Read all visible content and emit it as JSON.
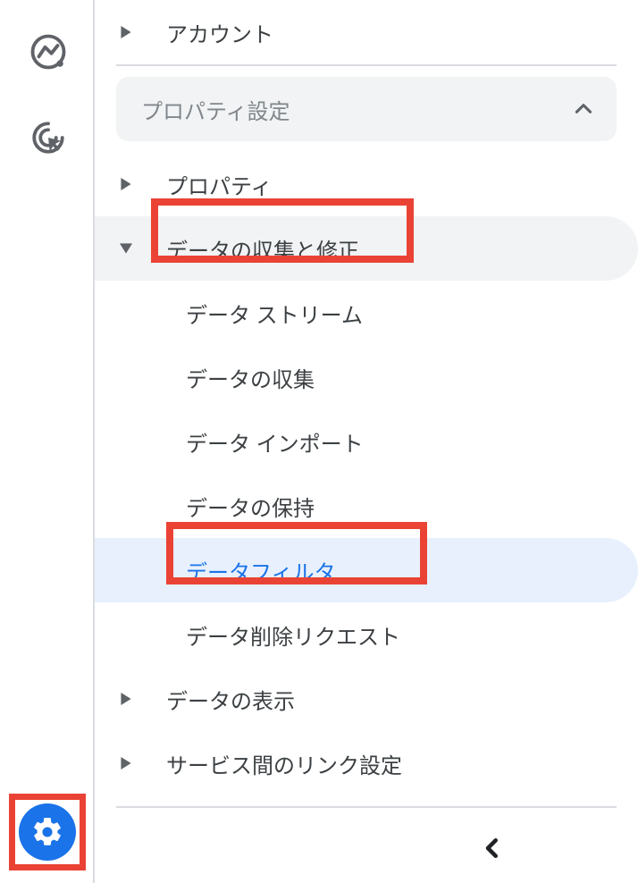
{
  "sidebar": {
    "account_label": "アカウント",
    "section_header": "プロパティ設定",
    "items": {
      "property": "プロパティ",
      "data_collect_mod": "データの収集と修正",
      "data_display": "データの表示",
      "service_links": "サービス間のリンク設定"
    },
    "sub_items": {
      "data_streams": "データ ストリーム",
      "data_collection": "データの収集",
      "data_import": "データ インポート",
      "data_retention": "データの保持",
      "data_filter": "データフィルタ",
      "data_deletion": "データ削除リクエスト"
    }
  }
}
